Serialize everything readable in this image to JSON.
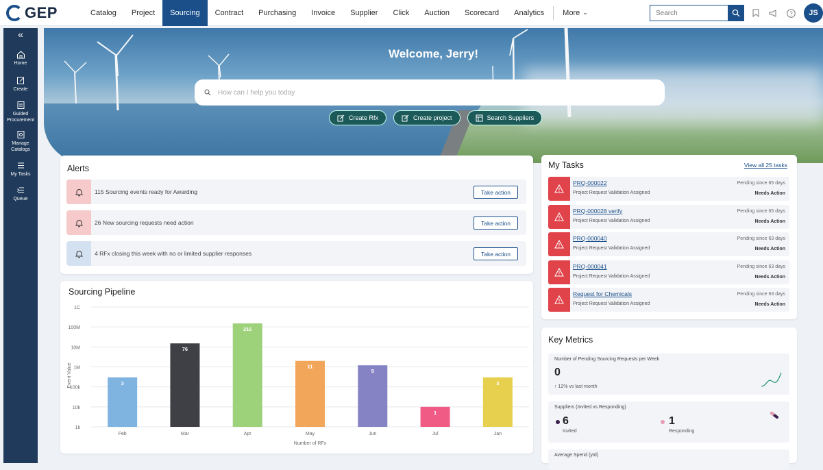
{
  "brand": {
    "logo_text": "GEP"
  },
  "nav": {
    "items": [
      "Catalog",
      "Project",
      "Sourcing",
      "Contract",
      "Purchasing",
      "Invoice",
      "Supplier",
      "Click",
      "Auction",
      "Scorecard",
      "Analytics"
    ],
    "active": "Sourcing",
    "more_label": "More"
  },
  "header": {
    "search_placeholder": "Search",
    "avatar_initials": "JS"
  },
  "sidebar": {
    "items": [
      {
        "label": "Home",
        "icon": "home-icon"
      },
      {
        "label": "Create",
        "icon": "create-icon"
      },
      {
        "label": "Guided Procurement",
        "icon": "guided-procurement-icon"
      },
      {
        "label": "Manage Catalogs",
        "icon": "manage-catalogs-icon"
      },
      {
        "label": "My Tasks",
        "icon": "list-icon"
      },
      {
        "label": "Queue",
        "icon": "queue-icon"
      }
    ]
  },
  "banner": {
    "welcome": "Welcome, Jerry!",
    "ask_placeholder": "How can I help you today",
    "actions": [
      "Create Rfx",
      "Create project",
      "Search Suppliers"
    ]
  },
  "alerts": {
    "title": "Alerts",
    "action_label": "Take action",
    "items": [
      {
        "text": "115 Sourcing events ready for Awarding",
        "color": "#f6c9cb"
      },
      {
        "text": "26 New sourcing requests need action",
        "color": "#f6c9cb"
      },
      {
        "text": "4 RFx closing this week with no or limited supplier responses",
        "color": "#d4e1f1"
      }
    ]
  },
  "pipeline": {
    "title": "Sourcing Pipeline"
  },
  "chart_data": {
    "type": "bar",
    "title": "Sourcing Pipeline",
    "xlabel": "Number of RFx",
    "ylabel": "Event Value",
    "y_scale": "log",
    "y_ticks": [
      "1k",
      "10k",
      "100k",
      "1M",
      "10M",
      "100M",
      "1C"
    ],
    "categories": [
      "Feb",
      "Mar",
      "Apr",
      "May",
      "Jun",
      "Jul",
      "Jan"
    ],
    "values": [
      300000,
      15000000,
      150000000,
      2000000,
      1200000,
      10000,
      300000
    ],
    "labels": [
      "3",
      "76",
      "216",
      "11",
      "5",
      "1",
      "3"
    ],
    "colors": [
      "#7fb3e0",
      "#3f3f46",
      "#9dd17a",
      "#f2a65a",
      "#8683c4",
      "#ef5b84",
      "#e8d04f"
    ]
  },
  "tasks": {
    "title": "My Tasks",
    "view_all": "View all 25 tasks",
    "items": [
      {
        "id": "PRQ-000022",
        "sub": "Project Request Validation Assigned",
        "pending": "Pending since 65 days",
        "action": "Needs Action"
      },
      {
        "id": "PRQ-000028 verify",
        "sub": "Project Request Validation Assigned",
        "pending": "Pending since 65 days",
        "action": "Needs Action"
      },
      {
        "id": "PRQ-000040",
        "sub": "Project Request Validation Assigned",
        "pending": "Pending since 63 days",
        "action": "Needs Action"
      },
      {
        "id": "PRQ-000041",
        "sub": "Project Request Validation Assigned",
        "pending": "Pending since 63 days",
        "action": "Needs Action"
      },
      {
        "id": "Request for Chemicals",
        "sub": "Project Request Validation Assigned",
        "pending": "Pending since 63 days",
        "action": "Needs Action"
      }
    ]
  },
  "metrics": {
    "title": "Key Metrics",
    "pending": {
      "label": "Number of Pending Sourcing Requests per Week",
      "value": "0",
      "delta": "↑ 12% vs last month"
    },
    "suppliers": {
      "label": "Suppliers (Invited vs Responding)",
      "invited_value": "6",
      "invited_label": "Invited",
      "responding_value": "1",
      "responding_label": "Responding"
    },
    "spend": {
      "label": "Average Spend (ytd)"
    }
  }
}
